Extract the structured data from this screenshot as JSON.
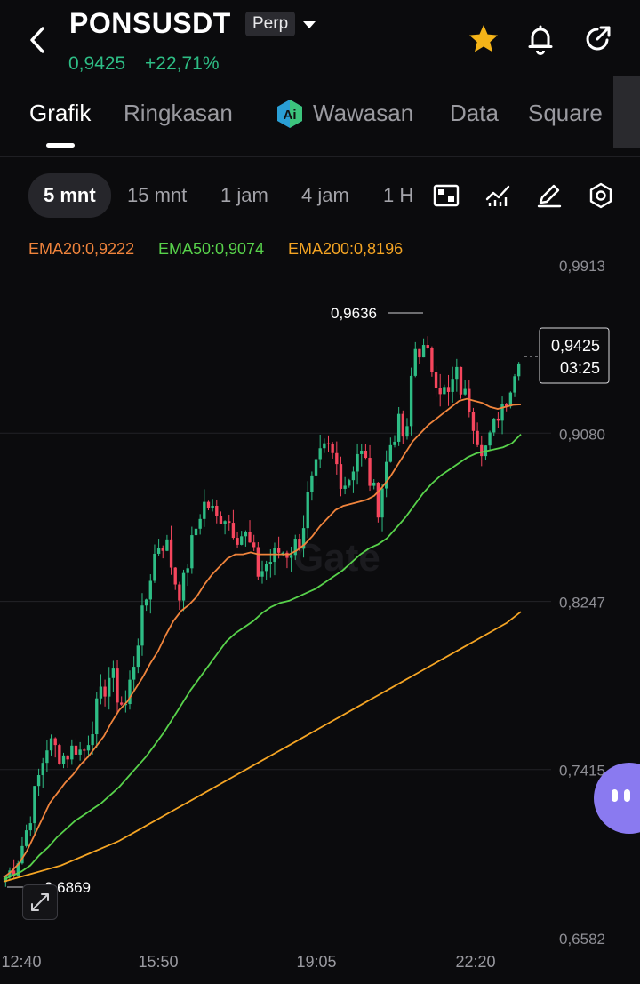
{
  "header": {
    "symbol": "PONSUSDT",
    "badge": "Perp",
    "price": "0,9425",
    "change_pct": "+22,71%",
    "icons": [
      "back-arrow-icon",
      "chevron-down-icon",
      "star-icon",
      "bell-icon",
      "share-icon"
    ],
    "star_color": "#f5b418"
  },
  "tabs": [
    "Grafik",
    "Ringkasan",
    "Wawasan",
    "Data",
    "Square"
  ],
  "active_tab": "Grafik",
  "intervals": [
    "5 mnt",
    "15 mnt",
    "1 jam",
    "4 jam",
    "1 H"
  ],
  "active_interval": "5 mnt",
  "toolbar_icons": [
    "layout-icon",
    "indicator-icon",
    "draw-icon",
    "settings-icon"
  ],
  "ema": {
    "ema20": "EMA20:0,9222",
    "ema50": "EMA50:0,9074",
    "ema200": "EMA200:0,8196",
    "colors": {
      "ema20": "#f0843c",
      "ema50": "#58d24b",
      "ema200": "#f5a524"
    }
  },
  "chart_data": {
    "type": "candlestick",
    "y_ticks": [
      "0,9913",
      "0,9080",
      "0,8247",
      "0,7415",
      "0,6582"
    ],
    "ylim": [
      0.6582,
      0.9913
    ],
    "x_ticks": [
      "12:40",
      "15:50",
      "19:05",
      "22:20"
    ],
    "high_label": "0,9636",
    "low_label": "0,6869",
    "last_price": "0,9425",
    "countdown": "03:25",
    "colors": {
      "up": "#2ebd85",
      "down": "#f6465d"
    },
    "watermark": "Gate",
    "close_path": [
      0.689,
      0.692,
      0.7,
      0.712,
      0.727,
      0.742,
      0.755,
      0.752,
      0.748,
      0.75,
      0.753,
      0.749,
      0.76,
      0.772,
      0.781,
      0.79,
      0.777,
      0.772,
      0.79,
      0.81,
      0.826,
      0.846,
      0.855,
      0.852,
      0.836,
      0.828,
      0.846,
      0.86,
      0.873,
      0.872,
      0.865,
      0.869,
      0.863,
      0.858,
      0.858,
      0.85,
      0.838,
      0.843,
      0.846,
      0.85,
      0.849,
      0.852,
      0.856,
      0.876,
      0.888,
      0.898,
      0.9,
      0.893,
      0.883,
      0.887,
      0.899,
      0.896,
      0.882,
      0.872,
      0.89,
      0.907,
      0.912,
      0.902,
      0.95,
      0.95,
      0.946,
      0.938,
      0.93,
      0.926,
      0.938,
      0.928,
      0.922,
      0.908,
      0.9,
      0.905,
      0.918,
      0.925,
      0.932,
      0.9425
    ],
    "ema20_values": [
      0.688,
      0.691,
      0.695,
      0.701,
      0.709,
      0.717,
      0.725,
      0.73,
      0.735,
      0.739,
      0.744,
      0.748,
      0.753,
      0.758,
      0.765,
      0.771,
      0.775,
      0.781,
      0.787,
      0.794,
      0.8,
      0.808,
      0.815,
      0.82,
      0.823,
      0.827,
      0.833,
      0.838,
      0.842,
      0.846,
      0.848,
      0.848,
      0.849,
      0.848,
      0.848,
      0.848,
      0.848,
      0.848,
      0.85,
      0.853,
      0.857,
      0.862,
      0.866,
      0.87,
      0.872,
      0.873,
      0.874,
      0.875,
      0.877,
      0.881,
      0.886,
      0.892,
      0.898,
      0.904,
      0.908,
      0.912,
      0.915,
      0.918,
      0.921,
      0.924,
      0.925,
      0.924,
      0.923,
      0.921,
      0.92,
      0.921,
      0.922,
      0.9222
    ],
    "ema50_values": [
      0.687,
      0.689,
      0.691,
      0.694,
      0.699,
      0.703,
      0.708,
      0.712,
      0.716,
      0.719,
      0.722,
      0.725,
      0.729,
      0.733,
      0.738,
      0.743,
      0.748,
      0.754,
      0.76,
      0.767,
      0.774,
      0.781,
      0.787,
      0.793,
      0.799,
      0.805,
      0.809,
      0.812,
      0.815,
      0.819,
      0.822,
      0.824,
      0.825,
      0.827,
      0.829,
      0.831,
      0.834,
      0.837,
      0.84,
      0.844,
      0.848,
      0.851,
      0.853,
      0.856,
      0.861,
      0.866,
      0.872,
      0.878,
      0.883,
      0.887,
      0.89,
      0.893,
      0.896,
      0.898,
      0.899,
      0.9,
      0.901,
      0.903,
      0.9074
    ],
    "ema200_values": [
      0.686,
      0.688,
      0.69,
      0.692,
      0.694,
      0.697,
      0.7,
      0.703,
      0.706,
      0.71,
      0.714,
      0.718,
      0.722,
      0.726,
      0.73,
      0.734,
      0.738,
      0.742,
      0.746,
      0.75,
      0.754,
      0.758,
      0.762,
      0.766,
      0.77,
      0.774,
      0.778,
      0.782,
      0.786,
      0.79,
      0.794,
      0.798,
      0.802,
      0.806,
      0.81,
      0.814,
      0.8196
    ]
  }
}
